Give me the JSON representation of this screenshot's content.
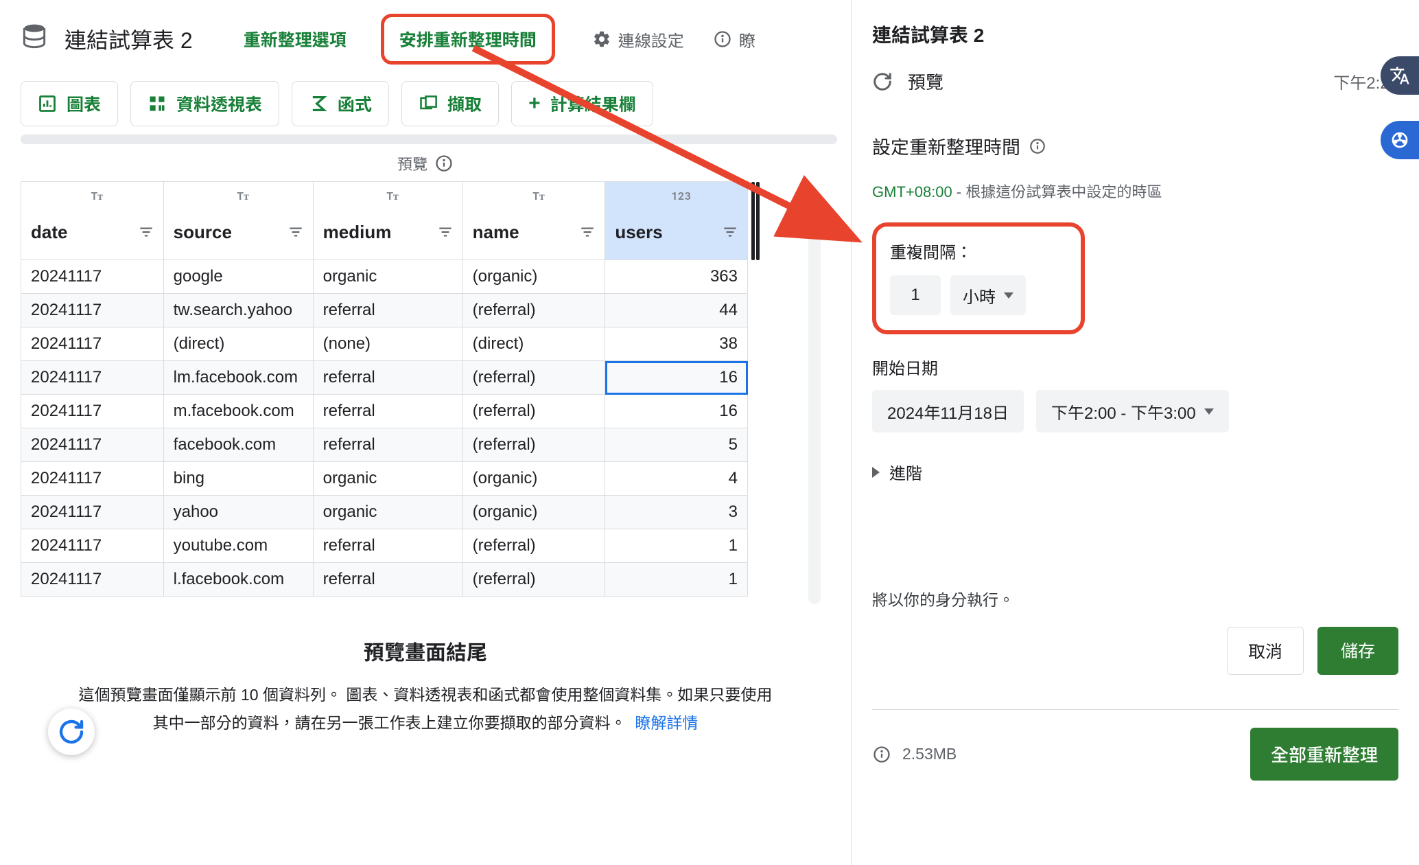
{
  "main": {
    "title": "連結試算表 2",
    "refresh_options": "重新整理選項",
    "schedule_refresh": "安排重新整理時間",
    "connection_settings": "連線設定",
    "learn_trunc": "瞭",
    "tabs": {
      "chart": "圖表",
      "pivot": "資料透視表",
      "function": "函式",
      "extract": "擷取",
      "calc_col": "計算結果欄"
    },
    "preview_label": "預覽"
  },
  "table": {
    "type_text": "Tᴛ",
    "type_num": "123",
    "headers": {
      "date": "date",
      "source": "source",
      "medium": "medium",
      "name": "name",
      "users": "users"
    },
    "rows": [
      {
        "date": "20241117",
        "source": "google",
        "medium": "organic",
        "name": "(organic)",
        "users": 363
      },
      {
        "date": "20241117",
        "source": "tw.search.yahoo",
        "medium": "referral",
        "name": "(referral)",
        "users": 44
      },
      {
        "date": "20241117",
        "source": "(direct)",
        "medium": "(none)",
        "name": "(direct)",
        "users": 38
      },
      {
        "date": "20241117",
        "source": "lm.facebook.com",
        "medium": "referral",
        "name": "(referral)",
        "users": 16
      },
      {
        "date": "20241117",
        "source": "m.facebook.com",
        "medium": "referral",
        "name": "(referral)",
        "users": 16
      },
      {
        "date": "20241117",
        "source": "facebook.com",
        "medium": "referral",
        "name": "(referral)",
        "users": 5
      },
      {
        "date": "20241117",
        "source": "bing",
        "medium": "organic",
        "name": "(organic)",
        "users": 4
      },
      {
        "date": "20241117",
        "source": "yahoo",
        "medium": "organic",
        "name": "(organic)",
        "users": 3
      },
      {
        "date": "20241117",
        "source": "youtube.com",
        "medium": "referral",
        "name": "(referral)",
        "users": 1
      },
      {
        "date": "20241117",
        "source": "l.facebook.com",
        "medium": "referral",
        "name": "(referral)",
        "users": 1
      }
    ],
    "selected_row": 3,
    "selected_col": "users"
  },
  "footer": {
    "title": "預覽畫面結尾",
    "body1": "這個預覽畫面僅顯示前 10 個資料列。  圖表、資料透視表和函式都會使用整個資料集。如果只要使用",
    "body2": "其中一部分的資料，請在另一張工作表上建立你要擷取的部分資料。",
    "learn_more": "瞭解詳情"
  },
  "side": {
    "title": "連結試算表 2",
    "preview": "預覽",
    "preview_time": "下午2:21",
    "section_title": "設定重新整理時間",
    "tz": "GMT+08:00",
    "tz_note": " - 根據這份試算表中設定的時區",
    "interval_label": "重複間隔：",
    "interval_value": "1",
    "interval_unit": "小時",
    "start_date_label": "開始日期",
    "start_date": "2024年11月18日",
    "start_time_range": "下午2:00 - 下午3:00",
    "advanced": "進階",
    "exec_as": "將以你的身分執行。",
    "cancel": "取消",
    "save": "儲存",
    "size": "2.53MB",
    "refresh_all": "全部重新整理"
  }
}
